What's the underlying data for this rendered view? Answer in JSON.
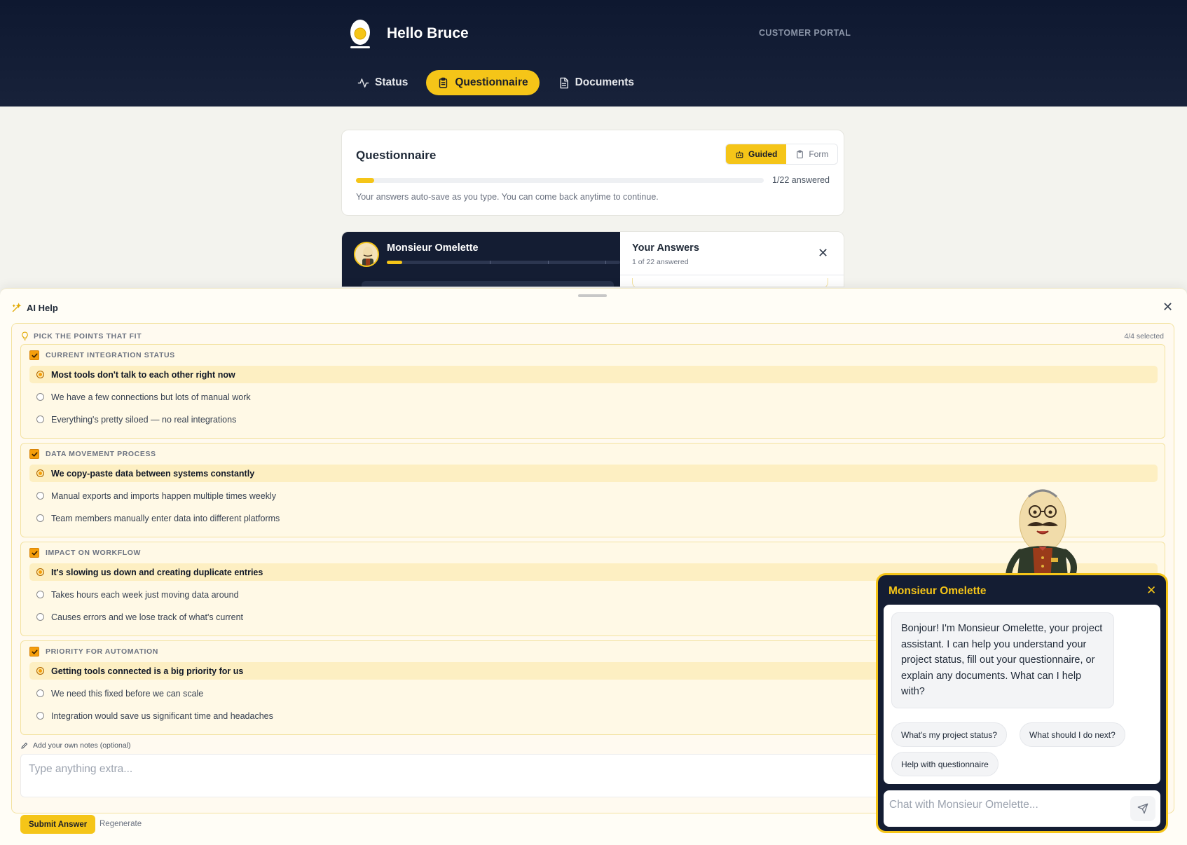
{
  "header": {
    "greeting": "Hello Bruce",
    "portal_label": "CUSTOMER PORTAL",
    "logo_icon": "egg-icon",
    "nav": [
      {
        "label": "Status",
        "icon": "activity-icon",
        "active": false
      },
      {
        "label": "Questionnaire",
        "icon": "clipboard-icon",
        "active": true
      },
      {
        "label": "Documents",
        "icon": "document-icon",
        "active": false
      }
    ]
  },
  "questionnaire": {
    "title": "Questionnaire",
    "modes": [
      {
        "label": "Guided",
        "icon": "robot-icon",
        "active": true
      },
      {
        "label": "Form",
        "icon": "clipboard-icon",
        "active": false
      }
    ],
    "progress_fraction": 0.045,
    "answered_label": "1/22 answered",
    "note": "Your answers auto-save as you type. You can come back anytime to continue."
  },
  "guided": {
    "assistant_name": "Monsieur Omelette",
    "progress_fraction": 0.065,
    "answers_title": "Your Answers",
    "answers_sub": "1 of 22 answered"
  },
  "ai_help": {
    "title": "AI Help",
    "pick_header": "PICK THE POINTS THAT FIT",
    "selected_count": "4/4 selected",
    "groups": [
      {
        "label": "CURRENT INTEGRATION STATUS",
        "options": [
          {
            "text": "Most tools don't talk to each other right now",
            "selected": true
          },
          {
            "text": "We have a few connections but lots of manual work",
            "selected": false
          },
          {
            "text": "Everything's pretty siloed — no real integrations",
            "selected": false
          }
        ]
      },
      {
        "label": "DATA MOVEMENT PROCESS",
        "options": [
          {
            "text": "We copy-paste data between systems constantly",
            "selected": true
          },
          {
            "text": "Manual exports and imports happen multiple times weekly",
            "selected": false
          },
          {
            "text": "Team members manually enter data into different platforms",
            "selected": false
          }
        ]
      },
      {
        "label": "IMPACT ON WORKFLOW",
        "options": [
          {
            "text": "It's slowing us down and creating duplicate entries",
            "selected": true
          },
          {
            "text": "Takes hours each week just moving data around",
            "selected": false
          },
          {
            "text": "Causes errors and we lose track of what's current",
            "selected": false
          }
        ]
      },
      {
        "label": "PRIORITY FOR AUTOMATION",
        "options": [
          {
            "text": "Getting tools connected is a big priority for us",
            "selected": true
          },
          {
            "text": "We need this fixed before we can scale",
            "selected": false
          },
          {
            "text": "Integration would save us significant time and headaches",
            "selected": false
          }
        ]
      }
    ],
    "notes_label": "Add your own notes (optional)",
    "notes_placeholder": "Type anything extra...",
    "submit_label": "Submit Answer",
    "regenerate_label": "Regenerate"
  },
  "chat": {
    "title": "Monsieur Omelette",
    "message": "Bonjour! I'm Monsieur Omelette, your project assistant. I can help you understand your project status, fill out your questionnaire, or explain any documents. What can I help with?",
    "suggestions": [
      "What's my project status?",
      "What should I do next?",
      "Help with questionnaire"
    ],
    "input_placeholder": "Chat with Monsieur Omelette..."
  },
  "colors": {
    "accent": "#f5c518",
    "header_bg": "#141d33",
    "checkbox": "#f59e0b"
  }
}
